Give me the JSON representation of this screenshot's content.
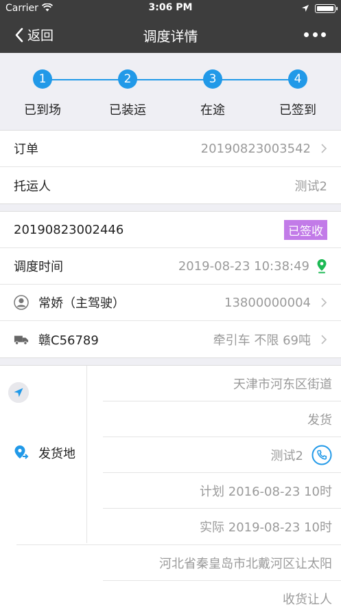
{
  "status_bar": {
    "carrier": "Carrier",
    "time": "3:06 PM"
  },
  "nav": {
    "back_label": "返回",
    "title": "调度详情"
  },
  "steps": [
    {
      "num": "1",
      "label": "已到场"
    },
    {
      "num": "2",
      "label": "已装运"
    },
    {
      "num": "3",
      "label": "在途"
    },
    {
      "num": "4",
      "label": "已签到"
    }
  ],
  "order": {
    "label": "订单",
    "value": "20190823003542"
  },
  "consignor": {
    "label": "托运人",
    "value": "测试2"
  },
  "dispatch": {
    "number": "20190823002446",
    "status": "已签收",
    "time_label": "调度时间",
    "time_value": "2019-08-23 10:38:49",
    "driver_label": "常娇（主驾驶）",
    "driver_phone": "13800000004",
    "vehicle_label": "赣C56789",
    "vehicle_value": "牵引车 不限 69吨"
  },
  "origin": {
    "label": "发货地",
    "address": "天津市河东区街道",
    "type": "发货",
    "contact": "测试2",
    "planned": "计划 2016-08-23 10时",
    "actual": "实际 2019-08-23 10时"
  },
  "destination": {
    "address": "河北省秦皇岛市北戴河区让太阳",
    "type": "收货让人"
  },
  "colors": {
    "accent": "#2199e8",
    "badge": "#c27be8",
    "pin": "#1db954",
    "header": "#3d3d3d"
  }
}
